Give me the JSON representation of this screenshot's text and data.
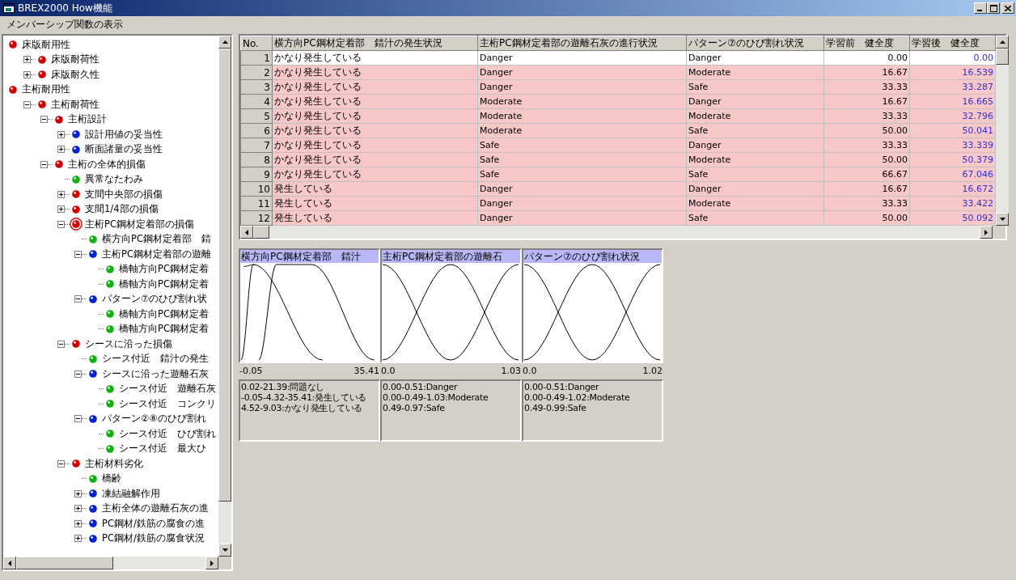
{
  "window": {
    "title": "BREX2000 How機能"
  },
  "menu": [
    "メンバーシップ関数の表示"
  ],
  "tree": [
    {
      "label": "床版耐用性",
      "color": "#d00000",
      "selected": false,
      "children": [
        {
          "label": "床版耐荷性",
          "color": "#d00000",
          "selected": false,
          "expanded": false
        },
        {
          "label": "床版耐久性",
          "color": "#d00000",
          "selected": false,
          "expanded": false
        }
      ]
    },
    {
      "label": "主桁耐用性",
      "color": "#d00000",
      "selected": false,
      "children": [
        {
          "label": "主桁耐荷性",
          "color": "#d00000",
          "selected": false,
          "expanded": true,
          "children": [
            {
              "label": "主桁設計",
              "color": "#d00000",
              "selected": false,
              "expanded": true,
              "children": [
                {
                  "label": "設計用値の妥当性",
                  "color": "#0020d0",
                  "selected": false,
                  "expanded": false
                },
                {
                  "label": "断面諸量の妥当性",
                  "color": "#0020d0",
                  "selected": false,
                  "expanded": false
                }
              ]
            },
            {
              "label": "主桁の全体的損傷",
              "color": "#d00000",
              "selected": false,
              "expanded": true,
              "children": [
                {
                  "label": "異常なたわみ",
                  "color": "#10b010",
                  "selected": false
                },
                {
                  "label": "支間中央部の損傷",
                  "color": "#d00000",
                  "selected": false,
                  "expanded": false
                },
                {
                  "label": "支間1/4部の損傷",
                  "color": "#d00000",
                  "selected": false,
                  "expanded": false
                },
                {
                  "label": "主桁PC鋼材定着部の損傷",
                  "color": "#d00000",
                  "selected": true,
                  "expanded": true,
                  "children": [
                    {
                      "label": "横方向PC鋼材定着部　錆",
                      "color": "#10b010",
                      "selected": false
                    },
                    {
                      "label": "主桁PC鋼材定着部の遊離",
                      "color": "#0020d0",
                      "selected": false,
                      "expanded": true,
                      "children": [
                        {
                          "label": "橋軸方向PC鋼材定着",
                          "color": "#10b010",
                          "selected": false
                        },
                        {
                          "label": "橋軸方向PC鋼材定着",
                          "color": "#10b010",
                          "selected": false
                        }
                      ]
                    },
                    {
                      "label": "パターン⑦のひび割れ状",
                      "color": "#0020d0",
                      "selected": false,
                      "expanded": true,
                      "children": [
                        {
                          "label": "橋軸方向PC鋼材定着",
                          "color": "#10b010",
                          "selected": false
                        },
                        {
                          "label": "橋軸方向PC鋼材定着",
                          "color": "#10b010",
                          "selected": false
                        }
                      ]
                    }
                  ]
                },
                {
                  "label": "シースに沿った損傷",
                  "color": "#d00000",
                  "selected": false,
                  "expanded": true,
                  "children": [
                    {
                      "label": "シース付近　錆汁の発生",
                      "color": "#10b010",
                      "selected": false
                    },
                    {
                      "label": "シースに沿った遊離石灰",
                      "color": "#0020d0",
                      "selected": false,
                      "expanded": true,
                      "children": [
                        {
                          "label": "シース付近　遊離石灰",
                          "color": "#10b010",
                          "selected": false
                        },
                        {
                          "label": "シース付近　コンクリ",
                          "color": "#10b010",
                          "selected": false
                        }
                      ]
                    },
                    {
                      "label": "パターン②⑧のひび割れ",
                      "color": "#0020d0",
                      "selected": false,
                      "expanded": true,
                      "children": [
                        {
                          "label": "シース付近　ひび割れ",
                          "color": "#10b010",
                          "selected": false
                        },
                        {
                          "label": "シース付近　最大ひ",
                          "color": "#10b010",
                          "selected": false
                        }
                      ]
                    }
                  ]
                },
                {
                  "label": "主桁材料劣化",
                  "color": "#d00000",
                  "selected": false,
                  "expanded": true,
                  "children": [
                    {
                      "label": "橋齢",
                      "color": "#10b010",
                      "selected": false
                    },
                    {
                      "label": "凍結融解作用",
                      "color": "#0020d0",
                      "selected": false,
                      "expanded": false
                    },
                    {
                      "label": "主桁全体の遊離石灰の進",
                      "color": "#0020d0",
                      "selected": false,
                      "expanded": false
                    },
                    {
                      "label": "PC鋼材/鉄筋の腐食の進",
                      "color": "#0020d0",
                      "selected": false,
                      "expanded": false
                    },
                    {
                      "label": "PC鋼材/鉄筋の腐食状況",
                      "color": "#0020d0",
                      "selected": false,
                      "expanded": false
                    }
                  ]
                }
              ]
            }
          ]
        }
      ]
    }
  ],
  "table": {
    "columns": [
      "No.",
      "横方向PC鋼材定着部　錆汁の発生状況",
      "主桁PC鋼材定着部の遊離石灰の進行状況",
      "パターン⑦のひび割れ状況",
      "学習前　健全度",
      "学習後　健全度"
    ],
    "rows": [
      {
        "selected": true,
        "cells": [
          "1",
          "かなり発生している",
          "Danger",
          "Danger",
          "0.00",
          "0.00"
        ]
      },
      {
        "selected": false,
        "cells": [
          "2",
          "かなり発生している",
          "Danger",
          "Moderate",
          "16.67",
          "16.539"
        ]
      },
      {
        "selected": false,
        "cells": [
          "3",
          "かなり発生している",
          "Danger",
          "Safe",
          "33.33",
          "33.287"
        ]
      },
      {
        "selected": false,
        "cells": [
          "4",
          "かなり発生している",
          "Moderate",
          "Danger",
          "16.67",
          "16.665"
        ]
      },
      {
        "selected": false,
        "cells": [
          "5",
          "かなり発生している",
          "Moderate",
          "Moderate",
          "33.33",
          "32.796"
        ]
      },
      {
        "selected": false,
        "cells": [
          "6",
          "かなり発生している",
          "Moderate",
          "Safe",
          "50.00",
          "50.041"
        ]
      },
      {
        "selected": false,
        "cells": [
          "7",
          "かなり発生している",
          "Safe",
          "Danger",
          "33.33",
          "33.339"
        ]
      },
      {
        "selected": false,
        "cells": [
          "8",
          "かなり発生している",
          "Safe",
          "Moderate",
          "50.00",
          "50.379"
        ]
      },
      {
        "selected": false,
        "cells": [
          "9",
          "かなり発生している",
          "Safe",
          "Safe",
          "66.67",
          "67.046"
        ]
      },
      {
        "selected": false,
        "cells": [
          "10",
          "発生している",
          "Danger",
          "Danger",
          "16.67",
          "16.672"
        ]
      },
      {
        "selected": false,
        "cells": [
          "11",
          "発生している",
          "Danger",
          "Moderate",
          "33.33",
          "33.422"
        ]
      },
      {
        "selected": false,
        "cells": [
          "12",
          "発生している",
          "Danger",
          "Safe",
          "50.00",
          "50.092"
        ]
      }
    ]
  },
  "membership_panels": [
    {
      "title": "横方向PC鋼材定着部　錆汁",
      "x_min": "-0.05",
      "x_max": "35.41",
      "legend": [
        "0.02-21.39:問題なし",
        "-0.05-4.32-35.41:発生している",
        "4.52-9.03:かなり発生している"
      ]
    },
    {
      "title": "主桁PC鋼材定着部の遊離石",
      "x_min": "0.0",
      "x_max": "1.03",
      "legend": [
        "0.00-0.51:Danger",
        "0.00-0.49-1.03:Moderate",
        "0.49-0.97:Safe"
      ]
    },
    {
      "title": "パターン⑦のひび割れ状況",
      "x_min": "0.0",
      "x_max": "1.02",
      "legend": [
        "0.00-0.51:Danger",
        "0.00-0.49-1.02:Moderate",
        "0.49-0.99:Safe"
      ]
    }
  ]
}
